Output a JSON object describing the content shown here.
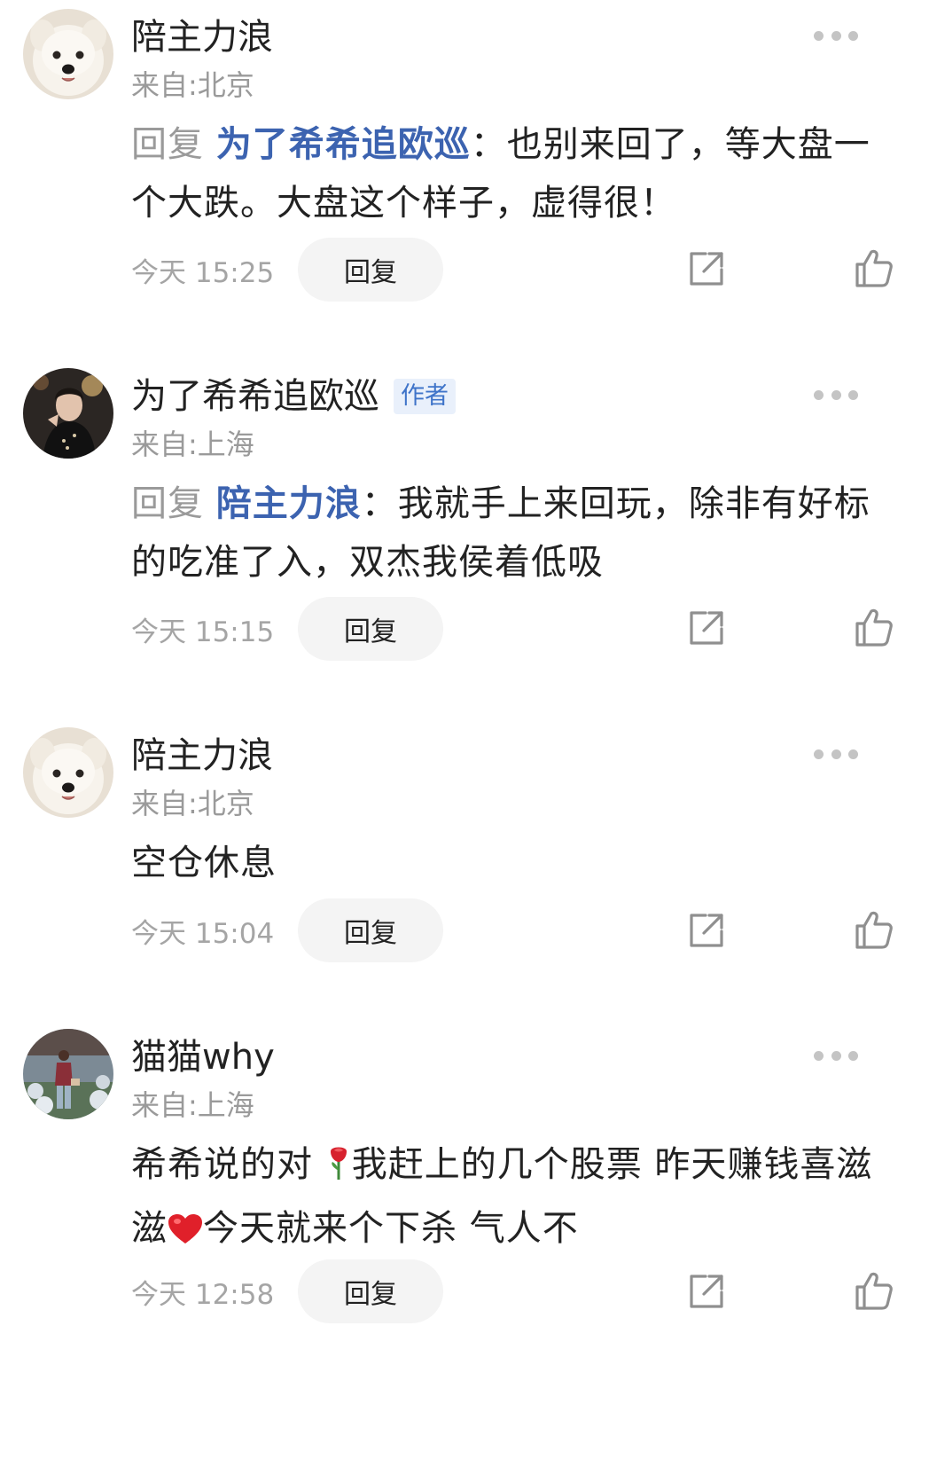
{
  "comments": [
    {
      "name": "陪主力浪",
      "location": "来自:北京",
      "reply_prefix": "回复",
      "mention": "为了希希追欧巡",
      "text": "：也别来回了，等大盘一个大跌。大盘这个样子，虚得很！",
      "time": "今天 15:25",
      "reply_label": "回复"
    },
    {
      "name": "为了希希追欧巡",
      "badge": "作者",
      "location": "来自:上海",
      "reply_prefix": "回复",
      "mention": "陪主力浪",
      "text": "：我就手上来回玩，除非有好标的吃准了入，双杰我侯着低吸",
      "time": "今天 15:15",
      "reply_label": "回复"
    },
    {
      "name": "陪主力浪",
      "location": "来自:北京",
      "text": "空仓休息",
      "time": "今天 15:04",
      "reply_label": "回复"
    },
    {
      "name": "猫猫why",
      "location": "来自:上海",
      "text_a": "希希说的对",
      "text_b": "我赶上的几个股票  昨天赚钱喜滋滋",
      "text_c": "今天就来个下杀  气人不",
      "time": "今天 12:58",
      "reply_label": "回复"
    }
  ],
  "icons": {
    "more": "more-dots-icon",
    "share": "share-icon",
    "like": "thumbs-up-icon",
    "rose": "rose-emoji",
    "heart": "red-heart-emoji"
  },
  "colors": {
    "mention": "#3c63b0",
    "secondary_text": "#9a9a9a",
    "badge_bg": "#e9f0fb",
    "badge_text": "#3f74c9",
    "button_bg": "#f4f4f4"
  }
}
